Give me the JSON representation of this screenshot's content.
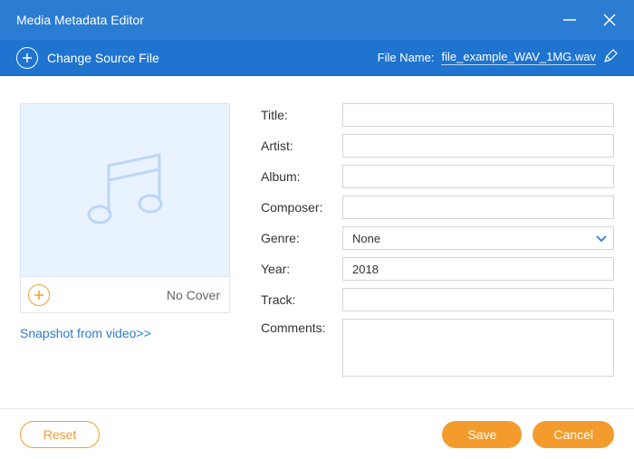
{
  "window": {
    "title": "Media Metadata Editor"
  },
  "toolbar": {
    "change_source_label": "Change Source File",
    "file_name_label": "File Name:",
    "file_name_value": "file_example_WAV_1MG.wav"
  },
  "cover": {
    "no_cover_label": "No Cover",
    "snapshot_link": "Snapshot from video>>"
  },
  "form": {
    "labels": {
      "title": "Title:",
      "artist": "Artist:",
      "album": "Album:",
      "composer": "Composer:",
      "genre": "Genre:",
      "year": "Year:",
      "track": "Track:",
      "comments": "Comments:"
    },
    "values": {
      "title": "",
      "artist": "",
      "album": "",
      "composer": "",
      "genre": "None",
      "year": "2018",
      "track": "",
      "comments": ""
    }
  },
  "footer": {
    "reset": "Reset",
    "save": "Save",
    "cancel": "Cancel"
  }
}
